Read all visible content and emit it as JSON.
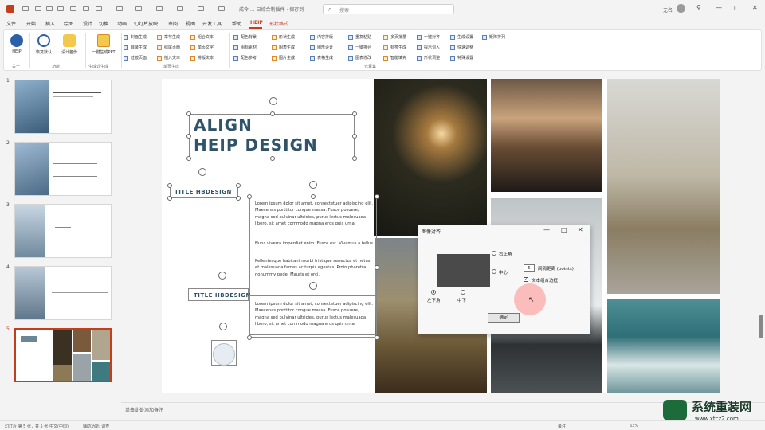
{
  "titlebar": {
    "filename": "成今 ... 日综合制插件  ·  保存到",
    "search_placeholder": "搜索",
    "user": "无名",
    "controls": [
      "—",
      "□",
      "✕"
    ]
  },
  "menu": {
    "items": [
      "文件",
      "开始",
      "插入",
      "绘图",
      "设计",
      "切换",
      "动画",
      "幻灯片放映",
      "审阅",
      "视图",
      "开发工具",
      "帮助",
      "HEIP",
      "形状格式"
    ],
    "active": "HEIP",
    "comment_label": "批注",
    "share_label": "共享"
  },
  "ribbon": {
    "groups": [
      {
        "label": "关于",
        "buttons": [
          {
            "label": "HEIP",
            "icon": "heip-logo-icon"
          }
        ]
      },
      {
        "label": "功能",
        "buttons": [
          {
            "label": "恢复默认",
            "icon": "reset-icon"
          },
          {
            "label": "设计备份",
            "icon": "backup-icon"
          }
        ]
      },
      {
        "label": "生成式生成",
        "buttons": [
          {
            "label": "一键生成PPT",
            "icon": "ppt-icon"
          }
        ]
      },
      {
        "label": "单页生成",
        "items": [
          "封面生成",
          "目录生成",
          "过渡页面",
          "章节生成",
          "结尾页面",
          "插入文本",
          "组合文本",
          "单页文字",
          "排版文本",
          "单页双块",
          "单页三块",
          "多页文案"
        ]
      },
      {
        "label": "元素集",
        "items": [
          "配色背景",
          "图标素材",
          "配色参考",
          "形状生成",
          "图表生成",
          "图片生成",
          "内容排版",
          "图形设计",
          "表格生成",
          "重复粘贴",
          "一键排列",
          "图表修改",
          "多页批量",
          "标签生成",
          "智能填充",
          "一键对齐",
          "提示词入",
          "形状调整",
          "生成设置",
          "快速调整",
          "特殊设置",
          "矩阵排列"
        ]
      }
    ]
  },
  "slides": [
    {
      "number": "1"
    },
    {
      "number": "2"
    },
    {
      "number": "3"
    },
    {
      "number": "4"
    },
    {
      "number": "5",
      "selected": true
    }
  ],
  "slide": {
    "title_line1": "ALIGN",
    "title_line2": "HEIP DESIGN",
    "subtitle1": "TITLE HBDESIGN",
    "subtitle2": "TITLE HBDESIGN",
    "para1": "Lorem ipsum dolor sit amet, consectetuer adipiscing elit. Maecenas porttitor congue massa. Fusce posuere, magna sed pulvinar ultricies, purus lectus malesuada libero, sit amet commodo magna eros quis urna.",
    "para2": "Nunc viverra imperdiet enim. Fusce est. Vivamus a tellus.",
    "para3": "Pellentesque habitant morbi tristique senectus et netus et malesuada fames ac turpis egestas. Proin pharetra nonummy pede. Mauris et orci.",
    "para4": "Lorem ipsum dolor sit amet, consectetuer adipiscing elit. Maecenas porttitor congue massa. Fusce posuere, magna sed pulvinar ultricies, purus lectus malesuada libero, sit amet commodo magna eros quis urna."
  },
  "dialog": {
    "title": "图像对齐",
    "opt_topright": "右上角",
    "opt_center": "中心",
    "opt_bottomleft": "左下角",
    "opt_bottom": "中下",
    "spacing_value": "5",
    "spacing_label": "间隔距离 (points)",
    "checkbox_label": "文本组合边框",
    "ok_label": "确定"
  },
  "notes": {
    "placeholder": "单击此处添加备注"
  },
  "status": {
    "slide_info": "幻灯片 第 5 张，共 5 张",
    "language": "中文(中国)",
    "accessibility": "辅助功能: 调查",
    "notes_btn": "备注",
    "zoom": "63%"
  },
  "watermark": {
    "title": "系统重装网",
    "url": "www.xtcz2.com"
  },
  "colors": {
    "accent": "#c43e1c",
    "title_text": "#2f5368",
    "cursor_halo": "#ff8c8c"
  }
}
